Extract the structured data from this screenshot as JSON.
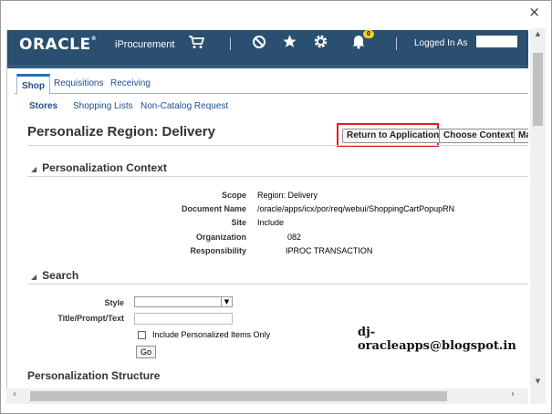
{
  "window": {
    "close_glyph": "×"
  },
  "header": {
    "logo": "ORACLE",
    "logo_mark": "®",
    "app_name": "iProcurement",
    "icons": [
      "cart-icon",
      "no-entry-icon",
      "star-icon",
      "gear-icon",
      "bell-icon"
    ],
    "notification_count": "0",
    "logged_in_label": "Logged In As"
  },
  "tabs": [
    {
      "label": "Shop",
      "active": true
    },
    {
      "label": "Requisitions"
    },
    {
      "label": "Receiving"
    }
  ],
  "subnav": [
    {
      "label": "Stores",
      "selected": true
    },
    {
      "label": "Shopping Lists"
    },
    {
      "label": "Non-Catalog Request"
    }
  ],
  "page": {
    "title": "Personalize Region: Delivery"
  },
  "buttons": {
    "return": "Return to Application",
    "choose_context": "Choose Context",
    "manage_truncated": "Man"
  },
  "context": {
    "heading": "Personalization Context",
    "fields": [
      {
        "label": "Scope",
        "value": "Region: Delivery"
      },
      {
        "label": "Document Name",
        "value": "/oracle/apps/icx/por/req/webui/ShoppingCartPopupRN"
      },
      {
        "label": "Site",
        "value": "Include"
      },
      {
        "label": "Organization",
        "value": "082"
      },
      {
        "label": "Responsibility",
        "value": "IPROC TRANSACTION"
      }
    ]
  },
  "search": {
    "heading": "Search",
    "style_label": "Style",
    "style_value": "",
    "title_label": "Title/Prompt/Text",
    "title_value": "",
    "checkbox_label": "Include Personalized Items Only",
    "go_label": "Go"
  },
  "watermark": "dj-oracleapps@blogspot.in",
  "structure": {
    "heading": "Personalization Structure"
  }
}
